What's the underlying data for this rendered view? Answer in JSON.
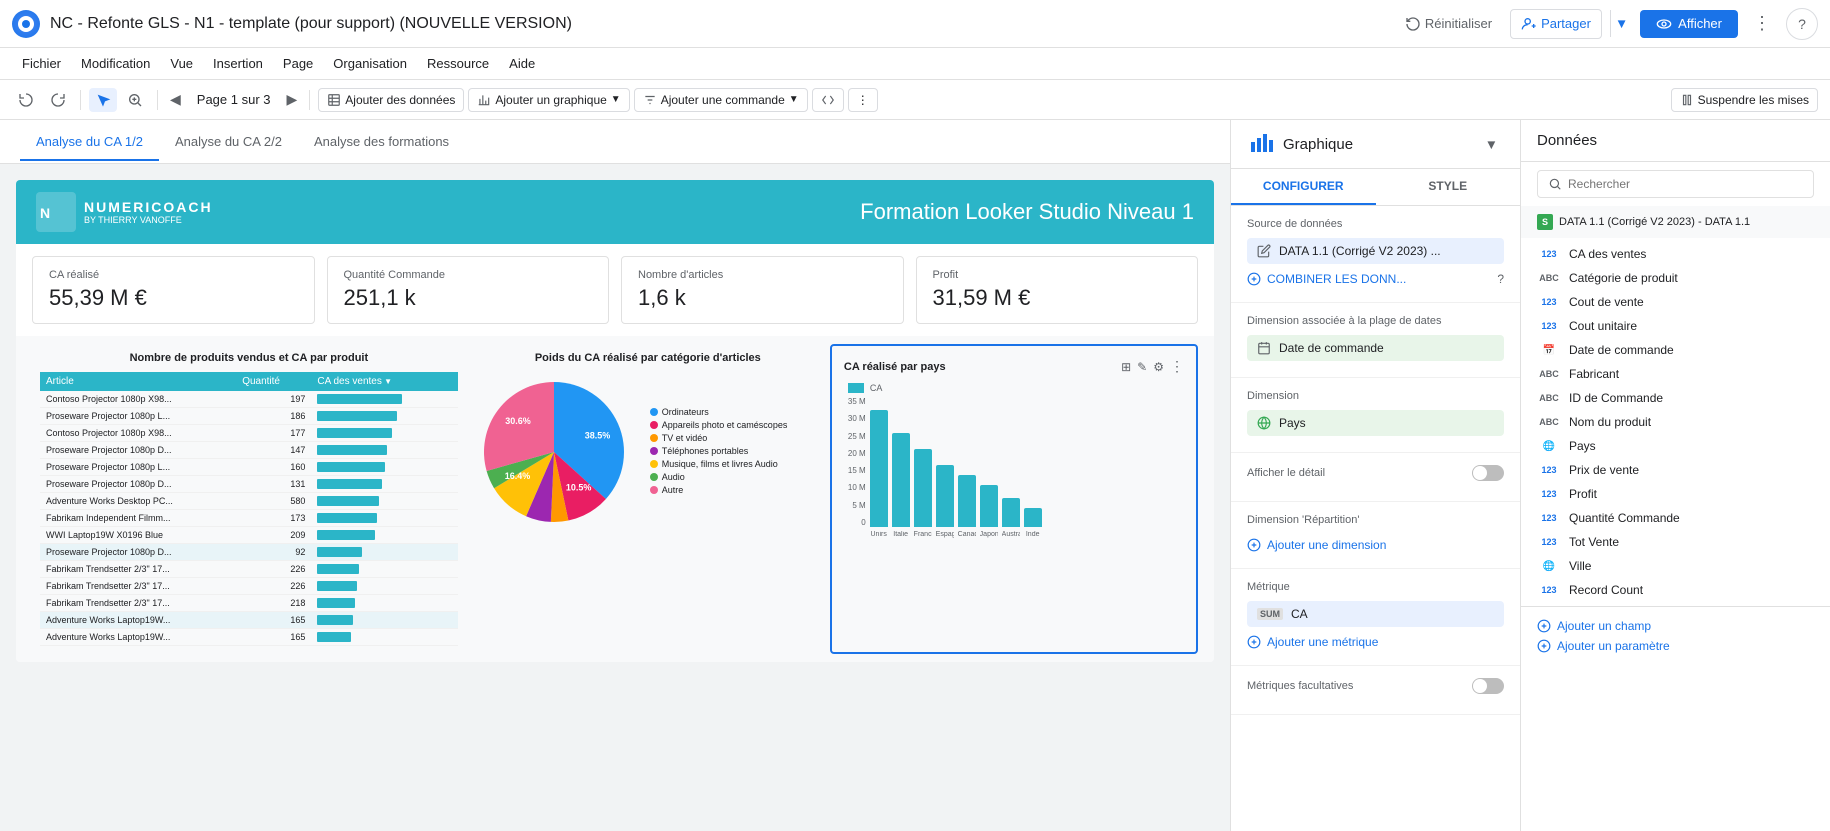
{
  "app": {
    "title": "NC - Refonte GLS - N1 - template (pour support) (NOUVELLE VERSION)"
  },
  "topbar": {
    "reinit_label": "Réinitialiser",
    "partager_label": "Partager",
    "afficher_label": "Afficher"
  },
  "menu": {
    "items": [
      "Fichier",
      "Modification",
      "Vue",
      "Insertion",
      "Page",
      "Organisation",
      "Ressource",
      "Aide"
    ]
  },
  "toolbar": {
    "page_label": "Page 1 sur 3",
    "add_data_label": "Ajouter des données",
    "add_chart_label": "Ajouter un graphique",
    "add_control_label": "Ajouter une commande",
    "suspend_label": "Suspendre les mises"
  },
  "tabs": {
    "items": [
      "Analyse du CA 1/2",
      "Analyse du CA 2/2",
      "Analyse des formations"
    ],
    "active": 0
  },
  "report": {
    "header": {
      "logo_main": "NUMERICOACH",
      "logo_sub": "BY THIERRY VANOFFE",
      "title": "Formation Looker Studio Niveau 1"
    },
    "kpis": [
      {
        "label": "CA réalisé",
        "value": "55,39 M €"
      },
      {
        "label": "Quantité Commande",
        "value": "251,1 k"
      },
      {
        "label": "Nombre d'articles",
        "value": "1,6 k"
      },
      {
        "label": "Profit",
        "value": "31,59 M €"
      }
    ],
    "charts": {
      "table": {
        "title": "Nombre de produits vendus et CA par produit",
        "headers": [
          "Article",
          "Quantité",
          "CA des ventes ↓"
        ],
        "rows": [
          {
            "name": "Contoso Projector 1080p X98...",
            "qty": "197",
            "bar": 85,
            "highlight": false
          },
          {
            "name": "Proseware Projector 1080p L...",
            "qty": "186",
            "bar": 80,
            "highlight": false
          },
          {
            "name": "Contoso Projector 1080p X98...",
            "qty": "177",
            "bar": 75,
            "highlight": false
          },
          {
            "name": "Proseware Projector 1080p D...",
            "qty": "147",
            "bar": 70,
            "highlight": false
          },
          {
            "name": "Proseware Projector 1080p L...",
            "qty": "160",
            "bar": 68,
            "highlight": false
          },
          {
            "name": "Proseware Projector 1080p D...",
            "qty": "131",
            "bar": 65,
            "highlight": false
          },
          {
            "name": "Adventure Works Desktop PC...",
            "qty": "580",
            "bar": 62,
            "highlight": false
          },
          {
            "name": "Fabrikam Independent Filmm...",
            "qty": "173",
            "bar": 60,
            "highlight": false
          },
          {
            "name": "WWI Laptop19W X0196 Blue",
            "qty": "209",
            "bar": 58,
            "highlight": false
          },
          {
            "name": "Proseware Projector 1080p D...",
            "qty": "92",
            "bar": 45,
            "highlight": true
          },
          {
            "name": "Fabrikam Trendsetter 2/3\" 17...",
            "qty": "226",
            "bar": 42,
            "highlight": false
          },
          {
            "name": "Fabrikam Trendsetter 2/3\" 17...",
            "qty": "226",
            "bar": 40,
            "highlight": false
          },
          {
            "name": "Fabrikam Trendsetter 2/3\" 17...",
            "qty": "218",
            "bar": 38,
            "highlight": false
          },
          {
            "name": "Adventure Works Laptop19W...",
            "qty": "165",
            "bar": 36,
            "highlight": true
          },
          {
            "name": "Adventure Works Laptop19W...",
            "qty": "165",
            "bar": 34,
            "highlight": false
          }
        ]
      },
      "pie": {
        "title": "Poids du CA réalisé par catégorie d'articles",
        "segments": [
          {
            "label": "Ordinateurs",
            "color": "#2196f3",
            "value": 38.5
          },
          {
            "label": "Appareils photo et caméscopes",
            "color": "#e91e63",
            "value": 10.5
          },
          {
            "label": "TV et vidéo",
            "color": "#ff9800",
            "value": 4.2
          },
          {
            "label": "Téléphones portables",
            "color": "#9c27b0",
            "value": 6.1
          },
          {
            "label": "Musique, films et livres Audio",
            "color": "#ffc107",
            "value": 10.3
          },
          {
            "label": "Audio",
            "color": "#4caf50",
            "value": 4.5
          },
          {
            "label": "Autre",
            "color": "#f06292",
            "value": 30.8
          }
        ],
        "labels": [
          "38.5%",
          "10.5%",
          "16.4%",
          "30.6%"
        ]
      },
      "bar": {
        "title": "CA réalisé par pays",
        "y_labels": [
          "35 M",
          "30 M",
          "25 M",
          "20 M",
          "15 M",
          "10 M",
          "5 M",
          "0"
        ],
        "bars": [
          {
            "country": "Unirs",
            "value": 90
          },
          {
            "country": "Italie",
            "value": 72
          },
          {
            "country": "France",
            "value": 60
          },
          {
            "country": "Espagne",
            "value": 48
          },
          {
            "country": "Canada",
            "value": 40
          },
          {
            "country": "Japon",
            "value": 32
          },
          {
            "country": "Australie",
            "value": 22
          },
          {
            "country": "Inde",
            "value": 15
          }
        ]
      }
    }
  },
  "right_panel": {
    "title": "Graphique",
    "tabs": [
      "CONFIGURER",
      "STYLE"
    ],
    "active_tab": 0,
    "sections": {
      "source": {
        "label": "Source de données",
        "source_name": "DATA 1.1 (Corrigé V2 2023) ...",
        "combine_label": "COMBINER LES DONN..."
      },
      "date_dim": {
        "label": "Dimension associée à la plage de dates",
        "value": "Date de commande"
      },
      "dimension": {
        "label": "Dimension",
        "value": "Pays"
      },
      "detail": {
        "label": "Afficher le détail",
        "enabled": false
      },
      "repartition": {
        "label": "Dimension 'Répartition'",
        "add_label": "Ajouter une dimension"
      },
      "metric": {
        "label": "Métrique",
        "agg": "SUM",
        "value": "CA",
        "add_label": "Ajouter une métrique"
      },
      "optional_metrics": {
        "label": "Métriques facultatives",
        "enabled": false
      }
    }
  },
  "data_panel": {
    "title": "Données",
    "search_placeholder": "Rechercher",
    "source_name": "DATA 1.1 (Corrigé V2 2023) - DATA 1.1",
    "fields": [
      {
        "type": "123",
        "name": "CA des ventes"
      },
      {
        "type": "ABC",
        "name": "Catégorie de produit"
      },
      {
        "type": "123",
        "name": "Cout de vente"
      },
      {
        "type": "123",
        "name": "Cout unitaire"
      },
      {
        "type": "CAL",
        "name": "Date de commande"
      },
      {
        "type": "ABC",
        "name": "Fabricant"
      },
      {
        "type": "ABC",
        "name": "ID de Commande"
      },
      {
        "type": "ABC",
        "name": "Nom du produit"
      },
      {
        "type": "GLOBE",
        "name": "Pays"
      },
      {
        "type": "123",
        "name": "Prix de vente"
      },
      {
        "type": "123",
        "name": "Profit"
      },
      {
        "type": "123",
        "name": "Quantité Commande"
      },
      {
        "type": "123",
        "name": "Tot Vente"
      },
      {
        "type": "GLOBE",
        "name": "Ville"
      },
      {
        "type": "123",
        "name": "Record Count"
      }
    ],
    "footer": {
      "add_field_label": "Ajouter un champ",
      "add_param_label": "Ajouter un paramètre"
    }
  }
}
